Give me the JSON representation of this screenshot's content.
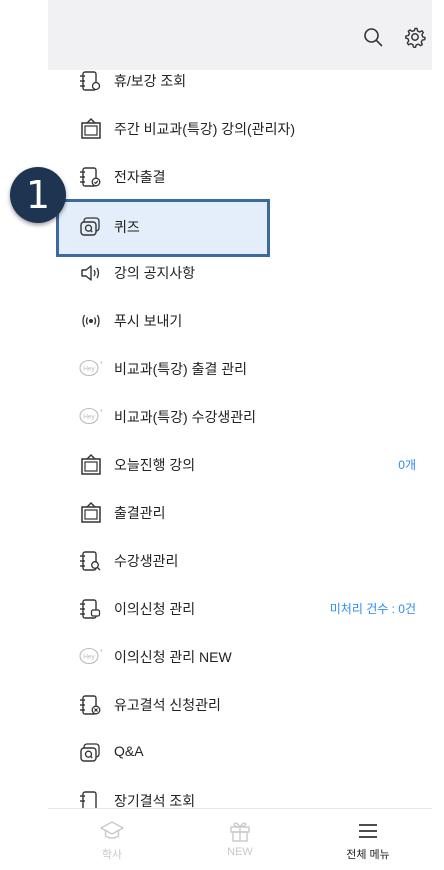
{
  "menu": {
    "items": [
      {
        "label": "휴/보강 조회",
        "icon": "calendar-doc-icon",
        "right": ""
      },
      {
        "label": "주간 비교과(특강) 강의(관리자)",
        "icon": "monitor-icon",
        "right": ""
      },
      {
        "label": "전자출결",
        "icon": "calendar-check-icon",
        "right": ""
      },
      {
        "label": "퀴즈",
        "icon": "quiz-icon",
        "right": ""
      },
      {
        "label": "강의 공지사항",
        "icon": "speaker-icon",
        "right": ""
      },
      {
        "label": "푸시 보내기",
        "icon": "broadcast-icon",
        "right": ""
      },
      {
        "label": "비교과(특강) 출결 관리",
        "icon": "hey-icon",
        "right": ""
      },
      {
        "label": "비교과(특강) 수강생관리",
        "icon": "hey-icon",
        "right": ""
      },
      {
        "label": "오늘진행 강의",
        "icon": "monitor-icon",
        "right": "0개"
      },
      {
        "label": "출결관리",
        "icon": "monitor-icon",
        "right": ""
      },
      {
        "label": "수강생관리",
        "icon": "calendar-search-icon",
        "right": ""
      },
      {
        "label": "이의신청 관리",
        "icon": "calendar-chat-icon",
        "right": "미처리 건수 : 0건"
      },
      {
        "label": "이의신청 관리 NEW",
        "icon": "hey-icon",
        "right": ""
      },
      {
        "label": "유고결석 신청관리",
        "icon": "calendar-x-icon",
        "right": ""
      },
      {
        "label": "Q&A",
        "icon": "quiz-icon",
        "right": ""
      },
      {
        "label": "장기결석 조회",
        "icon": "calendar-doc-icon",
        "right": ""
      }
    ]
  },
  "callout": {
    "number": "1"
  },
  "tabs": [
    {
      "label": "학사",
      "icon": "graduation-cap-icon"
    },
    {
      "label": "NEW",
      "icon": "gift-icon"
    },
    {
      "label": "전체 메뉴",
      "icon": "hamburger-menu-icon"
    }
  ],
  "hey_text": "Hey"
}
